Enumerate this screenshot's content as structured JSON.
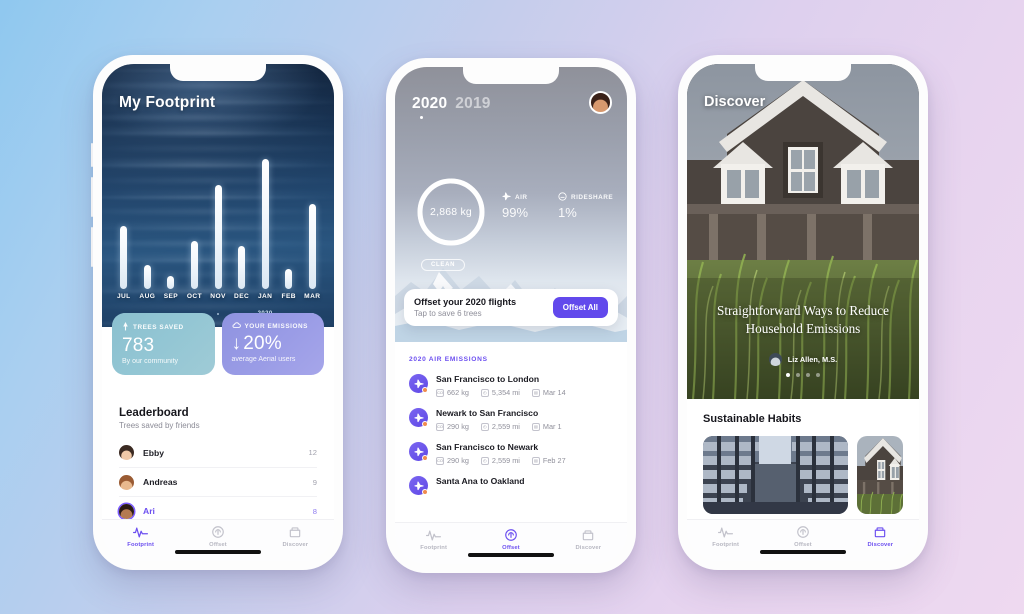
{
  "background": {
    "from": "#8fc8ef",
    "to": "#eed9f0"
  },
  "accent": "#6c4ff0",
  "phone1": {
    "title": "My Footprint",
    "chart_data": {
      "type": "bar",
      "title": "My Footprint",
      "categories": [
        "JUL",
        "AUG",
        "SEP",
        "OCT",
        "NOV",
        "DEC",
        "JAN",
        "FEB",
        "MAR"
      ],
      "values": [
        52,
        20,
        11,
        40,
        86,
        36,
        108,
        17,
        70
      ],
      "xlabel": "",
      "ylabel": "",
      "ylim": [
        0,
        120
      ],
      "grid": false,
      "annotation": "2020",
      "annotation_category": "JAN"
    },
    "cards": [
      {
        "icon": "tree-icon",
        "label": "TREES SAVED",
        "value": "783",
        "sub": "By our community",
        "color": "#93c6d4"
      },
      {
        "icon": "cloud-icon",
        "label": "YOUR EMISSIONS",
        "arrow": "↓",
        "value": "20%",
        "sub": "average Aerial users",
        "color": "#9a9ce6"
      }
    ],
    "leaderboard": {
      "title": "Leaderboard",
      "subtitle": "Trees saved by friends",
      "rows": [
        {
          "name": "Ebby",
          "score": "12",
          "active": false
        },
        {
          "name": "Andreas",
          "score": "9",
          "active": false
        },
        {
          "name": "Ari",
          "score": "8",
          "active": true
        }
      ]
    },
    "tabs": [
      {
        "label": "Footprint",
        "icon": "pulse-icon",
        "active": true
      },
      {
        "label": "Offset",
        "icon": "offset-icon",
        "active": false
      },
      {
        "label": "Discover",
        "icon": "discover-icon",
        "active": false
      }
    ]
  },
  "phone2": {
    "years": [
      {
        "label": "2020",
        "active": true
      },
      {
        "label": "2019",
        "active": false
      }
    ],
    "donut": {
      "value": "2,868 kg",
      "percent": 99
    },
    "legend": [
      {
        "icon": "plane-icon",
        "label": "AIR",
        "value": "99%"
      },
      {
        "icon": "rideshare-icon",
        "label": "RIDESHARE",
        "value": "1%"
      }
    ],
    "clean_pill": "CLEAN",
    "banner": {
      "title": "Offset your 2020 flights",
      "subtitle": "Tap to save 6 trees",
      "button": "Offset All"
    },
    "flights_header": "2020 AIR EMISSIONS",
    "flights": [
      {
        "route": "San Francisco to London",
        "kg": "662 kg",
        "mi": "5,354 mi",
        "date": "Mar 14"
      },
      {
        "route": "Newark to San Francisco",
        "kg": "290 kg",
        "mi": "2,559 mi",
        "date": "Mar 1"
      },
      {
        "route": "San Francisco to Newark",
        "kg": "290 kg",
        "mi": "2,559 mi",
        "date": "Feb 27"
      },
      {
        "route": "Santa Ana to Oakland",
        "kg": "",
        "mi": "",
        "date": ""
      }
    ],
    "tabs": [
      {
        "label": "Footprint",
        "icon": "pulse-icon",
        "active": false
      },
      {
        "label": "Offset",
        "icon": "offset-icon",
        "active": true
      },
      {
        "label": "Discover",
        "icon": "discover-icon",
        "active": false
      }
    ]
  },
  "phone3": {
    "title": "Discover",
    "article": {
      "title": "Straightforward Ways to Reduce Household Emissions",
      "author": "Liz Allen, M.S.",
      "carousel_dots": 4,
      "carousel_active": 1
    },
    "section_title": "Sustainable Habits",
    "tabs": [
      {
        "label": "Footprint",
        "icon": "pulse-icon",
        "active": false
      },
      {
        "label": "Offset",
        "icon": "offset-icon",
        "active": false
      },
      {
        "label": "Discover",
        "icon": "discover-icon",
        "active": true
      }
    ]
  }
}
